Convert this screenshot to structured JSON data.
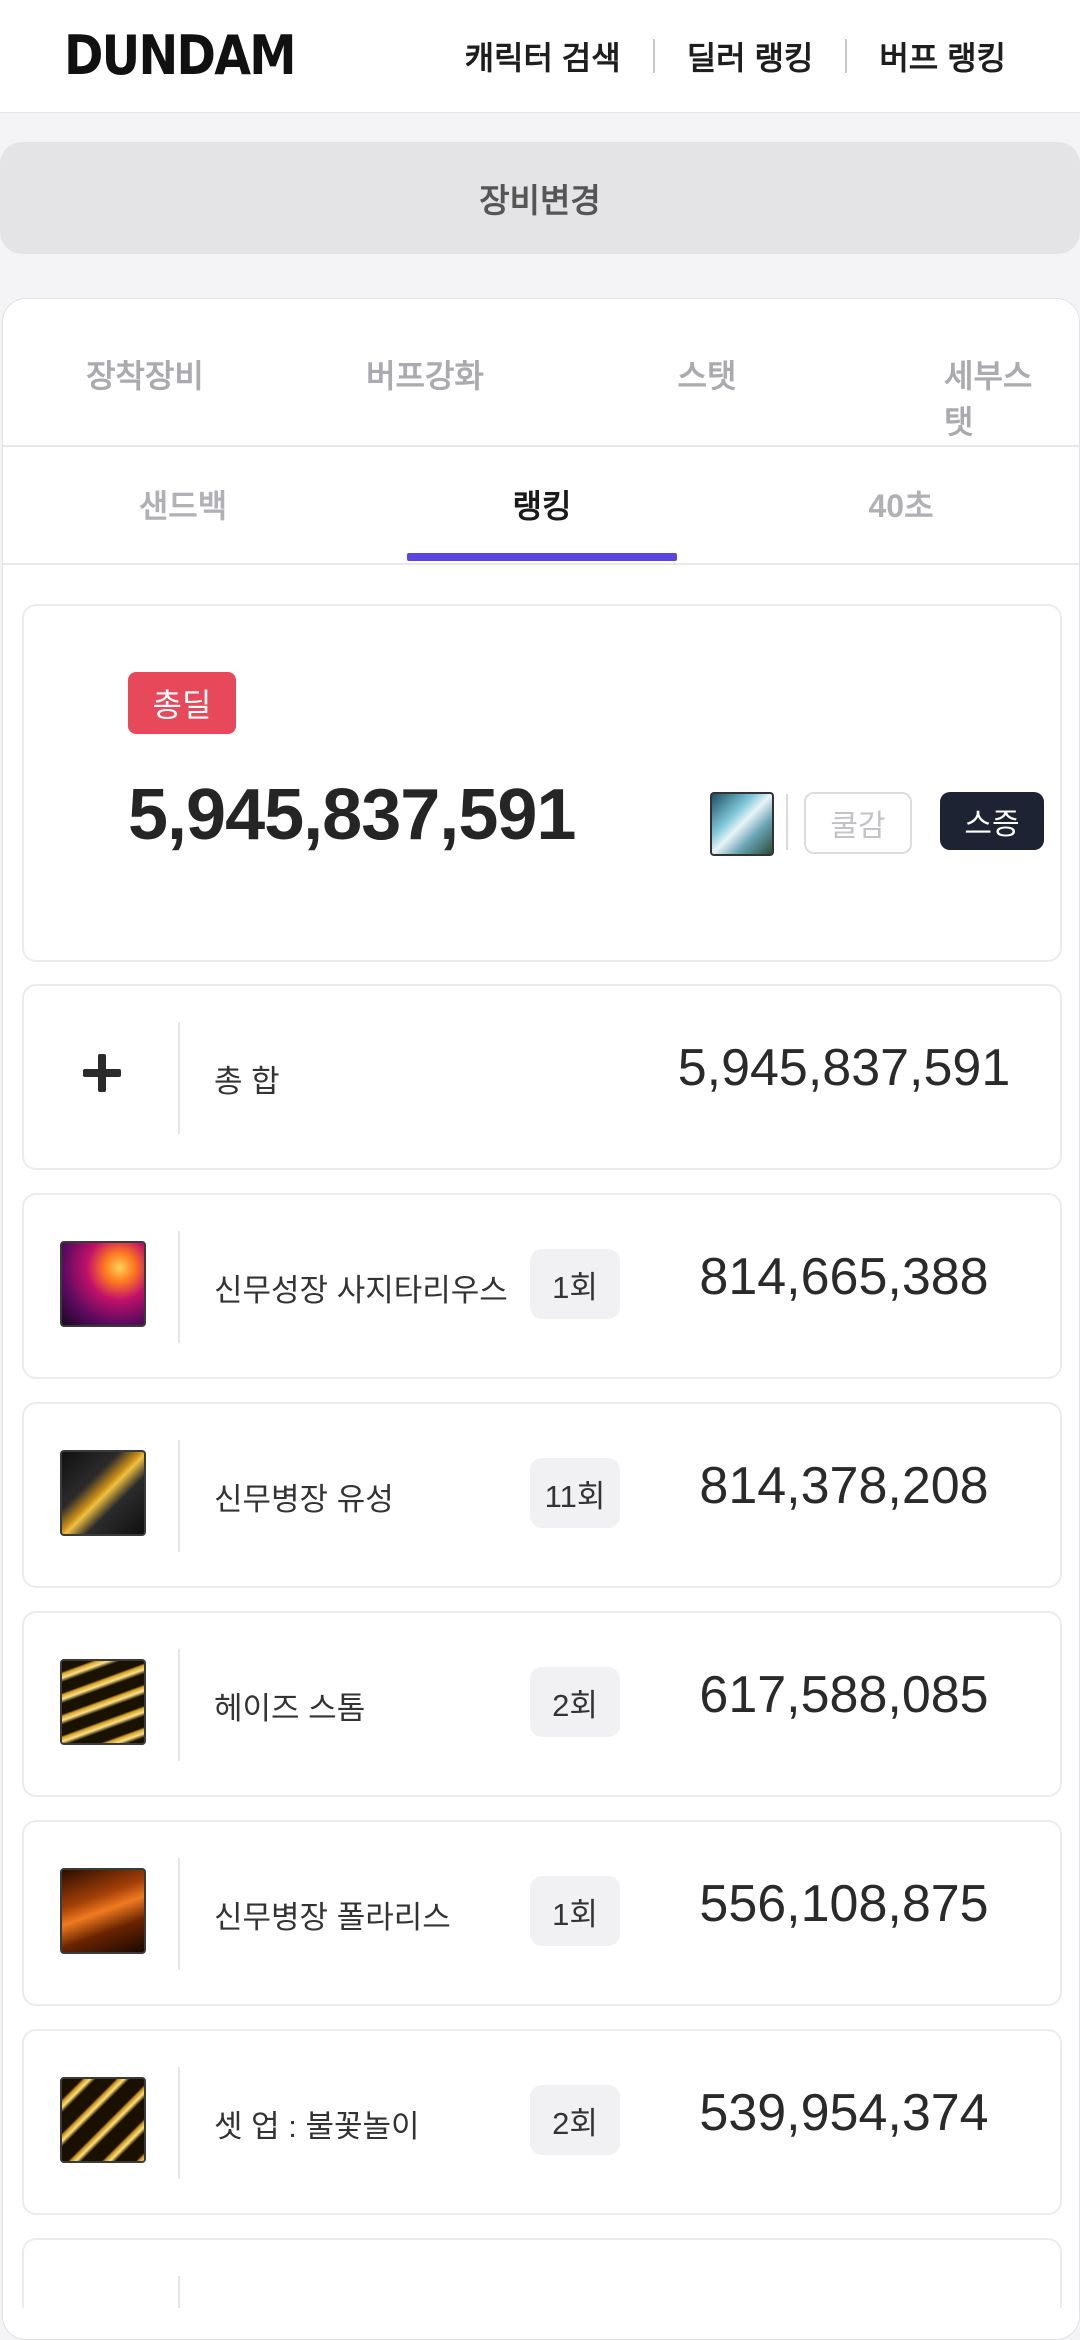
{
  "header": {
    "logo": "DUNDAM",
    "nav": [
      "캐릭터 검색",
      "딜러 랭킹",
      "버프 랭킹"
    ]
  },
  "change_equipment_label": "장비변경",
  "tabs_primary": [
    "장착장비",
    "버프강화",
    "스탯",
    "세부스탯"
  ],
  "tabs_secondary": {
    "items": [
      "샌드백",
      "랭킹",
      "40초"
    ],
    "active": "랭킹"
  },
  "summary": {
    "badge": "총딜",
    "total": "5,945,837,591",
    "cool_label": "쿨감",
    "stat_label": "스증"
  },
  "total_row": {
    "label": "총 합",
    "value": "5,945,837,591"
  },
  "skills": [
    {
      "name": "신무성장 사지타리우스",
      "count": "1회",
      "value": "814,665,388",
      "icon": "sagittarius-skill-icon"
    },
    {
      "name": "신무병장 유성",
      "count": "11회",
      "value": "814,378,208",
      "icon": "meteor-skill-icon"
    },
    {
      "name": "헤이즈 스톰",
      "count": "2회",
      "value": "617,588,085",
      "icon": "haze-storm-skill-icon"
    },
    {
      "name": "신무병장 폴라리스",
      "count": "1회",
      "value": "556,108,875",
      "icon": "polaris-skill-icon"
    },
    {
      "name": "셋 업 : 불꽃놀이",
      "count": "2회",
      "value": "539,954,374",
      "icon": "fireworks-skill-icon"
    }
  ]
}
